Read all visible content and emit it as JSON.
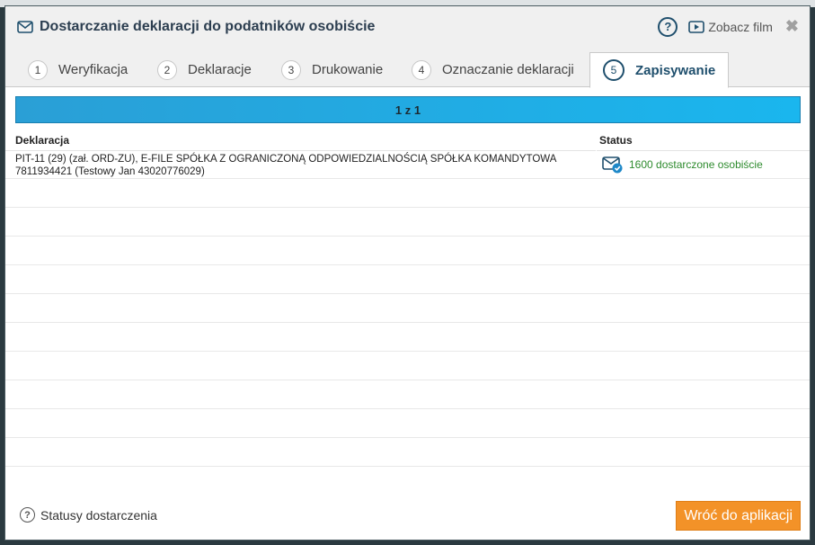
{
  "dialog": {
    "title": "Dostarczanie deklaracji do podatników osobiście",
    "help_label": "?",
    "film_label": "Zobacz film",
    "close_label": "✖"
  },
  "tabs": [
    {
      "num": "1",
      "label": "Weryfikacja",
      "active": false
    },
    {
      "num": "2",
      "label": "Deklaracje",
      "active": false
    },
    {
      "num": "3",
      "label": "Drukowanie",
      "active": false
    },
    {
      "num": "4",
      "label": "Oznaczanie deklaracji",
      "active": false
    },
    {
      "num": "5",
      "label": "Zapisywanie",
      "active": true
    }
  ],
  "progress": {
    "label": "1 z 1",
    "fraction": 1.0
  },
  "table": {
    "headers": {
      "deklaracja": "Deklaracja",
      "status": "Status"
    },
    "rows": [
      {
        "line1": "PIT-11 (29) (zał. ORD-ZU), E-FILE SPÓŁKA Z OGRANICZONĄ ODPOWIEDZIALNOŚCIĄ SPÓŁKA KOMANDYTOWA",
        "line2": "7811934421 (Testowy Jan 43020776029)",
        "status": "1600 dostarczone osobiście"
      }
    ]
  },
  "footer": {
    "legend_label": "Statusy dostarczenia",
    "back_label": "Wróć do aplikacji"
  },
  "colors": {
    "accent": "#1f4f6d",
    "progress": "#1ab6ee",
    "status_ok": "#2e8b2e",
    "button": "#f39228"
  }
}
